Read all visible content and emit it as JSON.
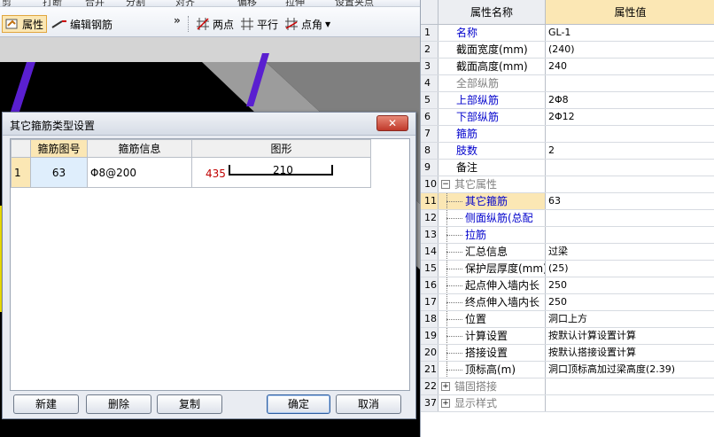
{
  "toolbar_top": {
    "items": [
      "剪",
      "打断",
      "合并",
      "分割",
      "对齐",
      "偏移",
      "拉伸",
      "设置夹点"
    ]
  },
  "toolbar": {
    "property_label": "属性",
    "edit_rebar_label": "编辑钢筋",
    "two_point_label": "两点",
    "parallel_label": "平行",
    "point_angle_label": "点角",
    "more_glyph": "»"
  },
  "dialog": {
    "title": "其它箍筋类型设置",
    "close_glyph": "✕",
    "columns": [
      "箍筋图号",
      "箍筋信息",
      "图形"
    ],
    "rows": [
      {
        "num": "1",
        "code": "63",
        "info": "Φ8@200",
        "shape_length": "435",
        "shape_value": "210"
      }
    ],
    "buttons": {
      "new": "新建",
      "delete": "删除",
      "copy": "复制",
      "ok": "确定",
      "cancel": "取消"
    }
  },
  "props": {
    "header_name": "属性名称",
    "header_value": "属性值",
    "rows": [
      {
        "num": "1",
        "name": "名称",
        "value": "GL-1",
        "style": "blue",
        "indent": 0
      },
      {
        "num": "2",
        "name": "截面宽度(mm)",
        "value": "(240)",
        "style": "",
        "indent": 0
      },
      {
        "num": "3",
        "name": "截面高度(mm)",
        "value": "240",
        "style": "",
        "indent": 0
      },
      {
        "num": "4",
        "name": "全部纵筋",
        "value": "",
        "style": "grey",
        "indent": 0
      },
      {
        "num": "5",
        "name": "上部纵筋",
        "value": "2Φ8",
        "style": "blue",
        "indent": 0
      },
      {
        "num": "6",
        "name": "下部纵筋",
        "value": "2Φ12",
        "style": "blue",
        "indent": 0
      },
      {
        "num": "7",
        "name": "箍筋",
        "value": "",
        "style": "blue",
        "indent": 0
      },
      {
        "num": "8",
        "name": "肢数",
        "value": "2",
        "style": "blue",
        "indent": 0
      },
      {
        "num": "9",
        "name": "备注",
        "value": "",
        "style": "",
        "indent": 0
      },
      {
        "num": "10",
        "name": "其它属性",
        "value": "",
        "style": "grey",
        "indent": 0,
        "expander": "−"
      },
      {
        "num": "11",
        "name": "其它箍筋",
        "value": "63",
        "style": "blue",
        "indent": 1,
        "selected": true
      },
      {
        "num": "12",
        "name": "侧面纵筋(总配",
        "value": "",
        "style": "blue",
        "indent": 1
      },
      {
        "num": "13",
        "name": "拉筋",
        "value": "",
        "style": "blue",
        "indent": 1
      },
      {
        "num": "14",
        "name": "汇总信息",
        "value": "过梁",
        "style": "",
        "indent": 1
      },
      {
        "num": "15",
        "name": "保护层厚度(mm)",
        "value": "(25)",
        "style": "",
        "indent": 1
      },
      {
        "num": "16",
        "name": "起点伸入墙内长",
        "value": "250",
        "style": "",
        "indent": 1
      },
      {
        "num": "17",
        "name": "终点伸入墙内长",
        "value": "250",
        "style": "",
        "indent": 1
      },
      {
        "num": "18",
        "name": "位置",
        "value": "洞口上方",
        "style": "",
        "indent": 1
      },
      {
        "num": "19",
        "name": "计算设置",
        "value": "按默认计算设置计算",
        "style": "",
        "indent": 1
      },
      {
        "num": "20",
        "name": "搭接设置",
        "value": "按默认搭接设置计算",
        "style": "",
        "indent": 1
      },
      {
        "num": "21",
        "name": "顶标高(m)",
        "value": "洞口顶标高加过梁高度(2.39)",
        "style": "",
        "indent": 1
      },
      {
        "num": "22",
        "name": "锚固搭接",
        "value": "",
        "style": "grey",
        "indent": 0,
        "expander": "+"
      },
      {
        "num": "37",
        "name": "显示样式",
        "value": "",
        "style": "grey",
        "indent": 0,
        "expander": "+"
      }
    ]
  },
  "colors": {
    "selected": "#fbe7b4",
    "accent_blue": "#0000cc",
    "canvas_beam": "#5a1fd0"
  }
}
